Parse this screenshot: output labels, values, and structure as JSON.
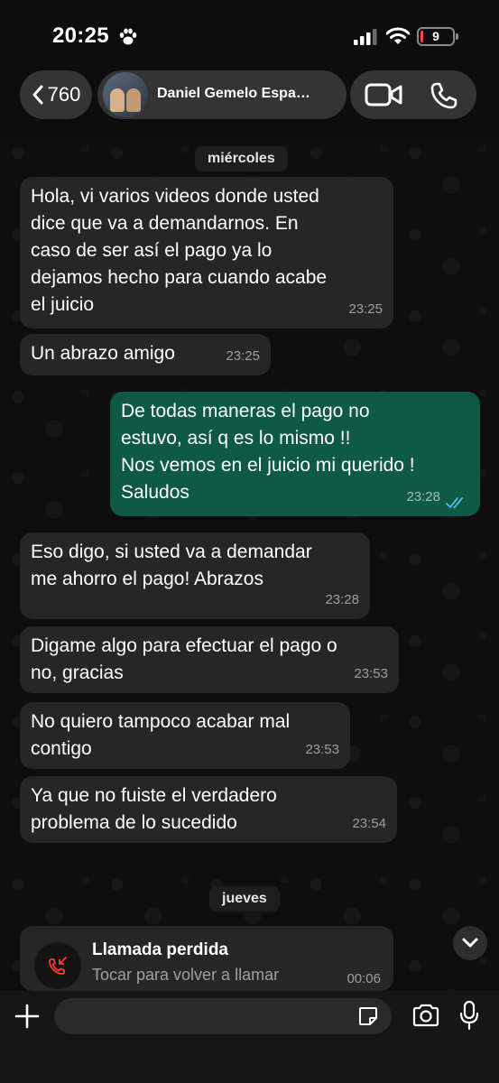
{
  "status_bar": {
    "time": "20:25",
    "battery_level": "9",
    "battery_fraction": 0.09
  },
  "header": {
    "back_count": "760",
    "contact_name": "Daniel Gemelo Espa…"
  },
  "chat": {
    "date_chips": [
      "miércoles",
      "jueves"
    ],
    "messages": [
      {
        "direction": "in",
        "text": "Hola, vi varios videos donde usted\ndice que va a demandarnos. En\ncaso de ser así el pago ya lo\ndejamos hecho para cuando acabe\nel juicio",
        "time": "23:25"
      },
      {
        "direction": "in",
        "text": "Un abrazo amigo",
        "time": "23:25"
      },
      {
        "direction": "out",
        "text": "De todas maneras el pago no\nestuvo, así q es lo mismo !!\nNos vemos en el juicio mi querido !\nSaludos",
        "time": "23:28",
        "read": true
      },
      {
        "direction": "in",
        "text": "Eso digo, si usted va a demandar\nme ahorro el pago! Abrazos",
        "time": "23:28"
      },
      {
        "direction": "in",
        "text": "Digame algo para efectuar el pago o\nno, gracias",
        "time": "23:53"
      },
      {
        "direction": "in",
        "text": "No quiero tampoco acabar mal\ncontigo",
        "time": "23:53"
      },
      {
        "direction": "in",
        "text": "Ya que no fuiste el verdadero\nproblema de lo sucedido",
        "time": "23:54"
      }
    ],
    "missed_call": {
      "title": "Llamada perdida",
      "subtitle": "Tocar para volver a llamar",
      "time": "00:06"
    }
  },
  "input_bar": {
    "placeholder": ""
  },
  "colors": {
    "outgoing_bubble": "#0e5a45",
    "incoming_bubble": "#262626",
    "read_ticks": "#53bdeb",
    "battery_low": "#ff453a",
    "missed_call_red": "#ff3b30"
  },
  "icons": [
    "paw-icon",
    "signal-icon",
    "wifi-icon",
    "battery-icon",
    "chevron-left-icon",
    "video-call-icon",
    "phone-icon",
    "double-check-icon",
    "missed-call-icon",
    "chevron-down-icon",
    "plus-icon",
    "sticker-icon",
    "camera-icon",
    "microphone-icon"
  ]
}
